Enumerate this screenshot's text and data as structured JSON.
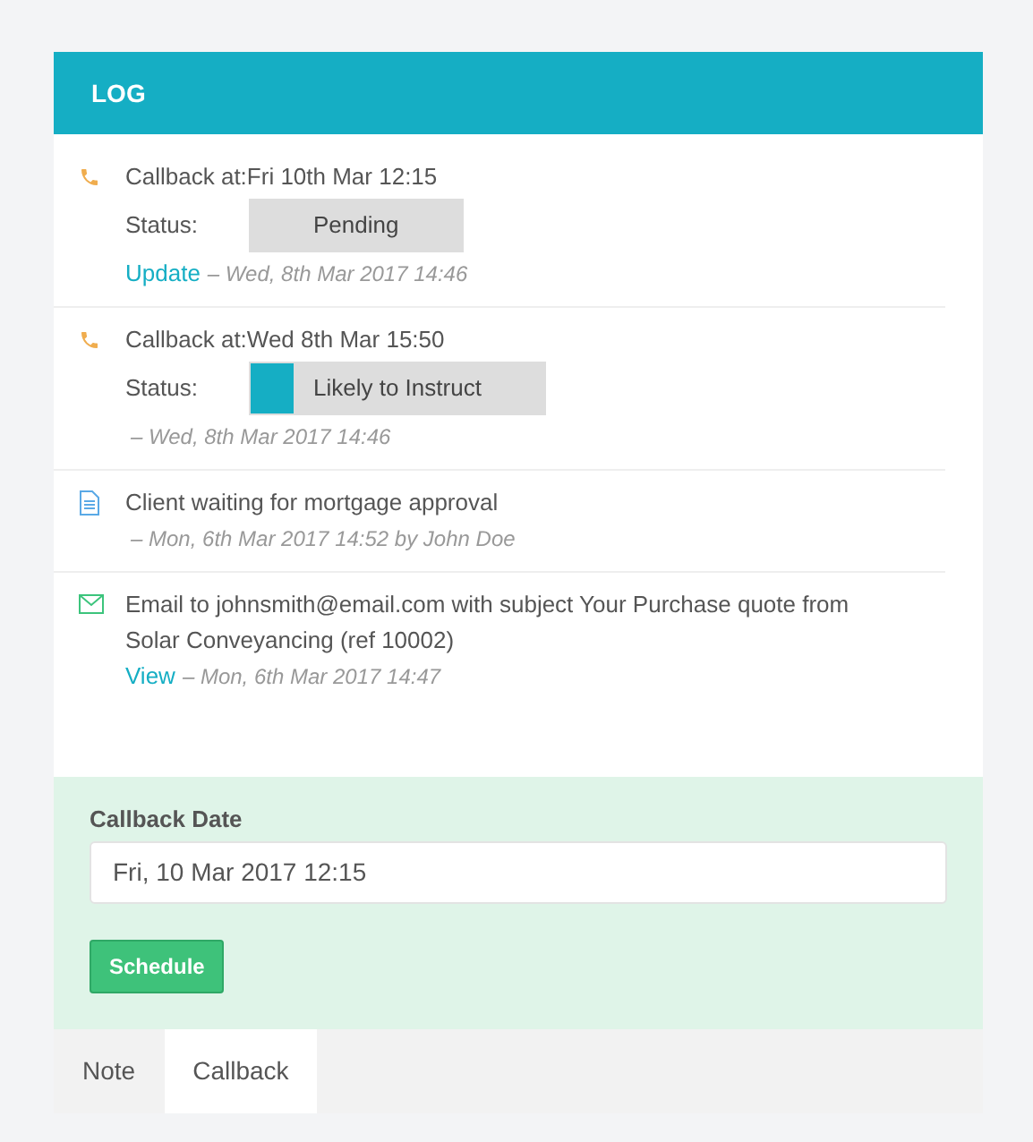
{
  "header": {
    "title": "LOG"
  },
  "entries": [
    {
      "kind": "call",
      "text": "Callback at:Fri 10th Mar 12:15",
      "status": {
        "label": "Status:",
        "value": "Pending"
      },
      "link": "Update",
      "meta": "– Wed, 8th Mar 2017 14:46"
    },
    {
      "kind": "call",
      "text": "Callback at:Wed 8th Mar 15:50",
      "status": {
        "label": "Status:",
        "value": "Likely to Instruct",
        "color": "#15aec4"
      },
      "meta": "– Wed, 8th Mar 2017 14:46"
    },
    {
      "kind": "note",
      "text": "Client waiting for mortgage approval",
      "meta": "– Mon, 6th Mar 2017 14:52 by John Doe"
    },
    {
      "kind": "email",
      "text": "Email to johnsmith@email.com with subject Your Purchase quote from Solar Conveyancing (ref 10002)",
      "link": "View",
      "meta": "– Mon, 6th Mar 2017 14:47"
    }
  ],
  "form": {
    "label": "Callback Date",
    "value": "Fri, 10 Mar 2017 12:15",
    "button": "Schedule"
  },
  "tabs": [
    {
      "label": "Note",
      "selected": false
    },
    {
      "label": "Callback",
      "selected": true
    }
  ]
}
